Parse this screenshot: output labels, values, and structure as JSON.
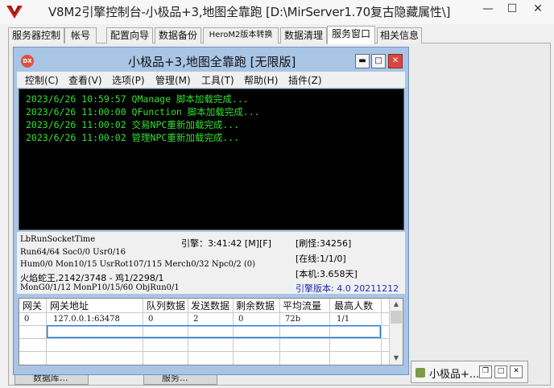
{
  "app": {
    "title": "V8M2引擎控制台-小极品+3,地图全靠跑 [D:\\MirServer1.70复古隐藏属性\\]",
    "minimize": "—",
    "restore": "☐",
    "close": "✕"
  },
  "tabs": [
    {
      "label": "服务器控制"
    },
    {
      "label": "帐号"
    },
    {
      "label": "配置向导"
    },
    {
      "label": "数据备份"
    },
    {
      "label": "HeroM2版本转换"
    },
    {
      "label": "数据清理"
    },
    {
      "label": "服务窗口",
      "active": true
    },
    {
      "label": "相关信息"
    }
  ],
  "window": {
    "logo": "DX",
    "title": "小极品+3,地图全靠跑 [无限版]",
    "btn_min": "▬",
    "btn_max": "□",
    "btn_close": "✕"
  },
  "menu": [
    "控制(C)",
    "查看(V)",
    "选项(P)",
    "管理(M)",
    "工具(T)",
    "帮助(H)",
    "插件(Z)"
  ],
  "log": [
    "2023/6/26 10:59:57 QManage 脚本加载完成...",
    "2023/6/26 11:00:00 QFunction 脚本加载完成...",
    "2023/6/26 11:00:02 交易NPC重新加载完成...",
    "2023/6/26 11:00:02 管理NPC重新加载完成..."
  ],
  "stats": {
    "socket": "LbRunSocketTime",
    "run": "Run64/64 Soc0/0 Usr0/16",
    "hum": "Hum0/0 Mon10/15 UsrRot107/115 Merch0/32 Npc0/2 (0)",
    "monster": "火焰蛇王,2142/3748 - 鸡1/2298/1",
    "mon_gen": "MonG0/1/12 MonP10/15/60 ObjRun0/1",
    "engine": "引擎：3:41:42 [M][F]",
    "refresh": "[刷怪:34256]",
    "online": "[在线:1/1/0]",
    "local": "[本机:3.658天]",
    "version": "引擎版本: 4.0 20211212"
  },
  "grid": {
    "headers": [
      "网关",
      "网关地址",
      "队列数据",
      "发送数据",
      "剩余数据",
      "平均流量",
      "最高人数"
    ],
    "rows": [
      [
        "0",
        "127.0.0.1:63478",
        "0",
        "2",
        "0",
        "72b",
        "1/1"
      ]
    ]
  },
  "mini_window": {
    "title": "小极品+...",
    "restore": "❐",
    "max": "□",
    "close": "✕"
  },
  "hidden_items": [
    "数据库...",
    "服务..."
  ]
}
